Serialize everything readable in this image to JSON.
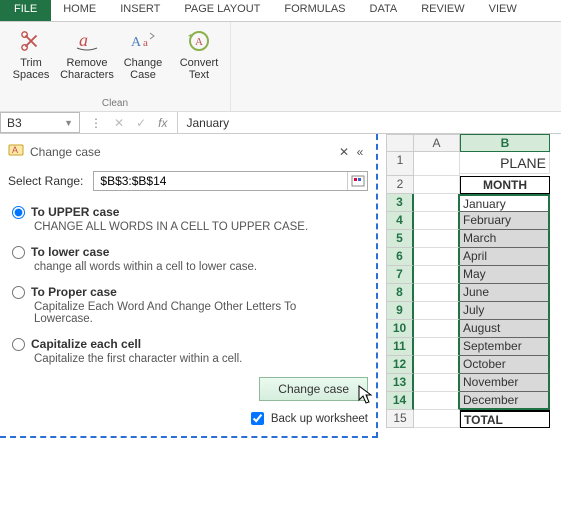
{
  "tabs": {
    "file": "FILE",
    "home": "HOME",
    "insert": "INSERT",
    "page_layout": "PAGE LAYOUT",
    "formulas": "FORMULAS",
    "data": "DATA",
    "review": "REVIEW",
    "view": "VIEW"
  },
  "ribbon": {
    "group_label": "Clean",
    "trim": "Trim Spaces",
    "remove": "Remove Characters",
    "change": "Change Case",
    "convert": "Convert Text"
  },
  "formula_bar": {
    "namebox": "B3",
    "fx": "fx",
    "value": "January"
  },
  "pane": {
    "title": "Change case",
    "select_label": "Select Range:",
    "range": "$B$3:$B$14",
    "opts": {
      "upper": {
        "label": "To UPPER case",
        "desc": "CHANGE ALL WORDS IN A CELL TO UPPER CASE."
      },
      "lower": {
        "label": "To lower case",
        "desc": "change all words within a cell to lower case."
      },
      "proper": {
        "label": "To Proper case",
        "desc": "Capitalize Each Word And Change Other Letters To Lowercase."
      },
      "capcell": {
        "label": "Capitalize each cell",
        "desc": "Capitalize the first character within a cell."
      }
    },
    "button": "Change case",
    "backup": "Back up worksheet"
  },
  "grid": {
    "col_a": "A",
    "col_b": "B",
    "plane": "PLANE",
    "month_header": "MONTH",
    "months": [
      "January",
      "February",
      "March",
      "April",
      "May",
      "June",
      "July",
      "August",
      "September",
      "October",
      "November",
      "December"
    ],
    "total": "TOTAL"
  }
}
